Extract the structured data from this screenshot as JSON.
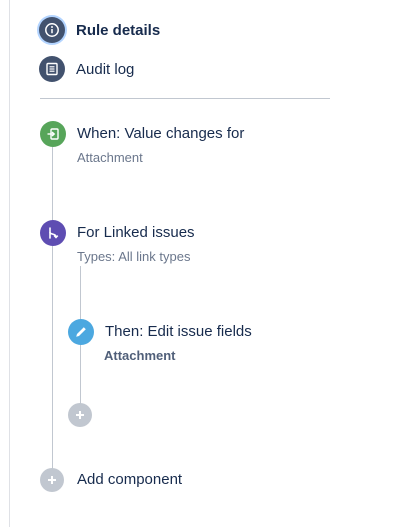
{
  "nav": {
    "rule_details": "Rule details",
    "audit_log": "Audit log"
  },
  "trigger": {
    "title": "When: Value changes for",
    "subtitle": "Attachment",
    "color": "#57a55a"
  },
  "branch": {
    "title": "For Linked issues",
    "subtitle": "Types: All link types",
    "color": "#5e4db2"
  },
  "action": {
    "title": "Then: Edit issue fields",
    "subtitle": "Attachment",
    "color": "#4ca8e0"
  },
  "add_component_label": "Add component",
  "colors": {
    "nav_icon": "#42526e",
    "add_icon": "#c1c7d0",
    "line": "#c1c7d0"
  }
}
